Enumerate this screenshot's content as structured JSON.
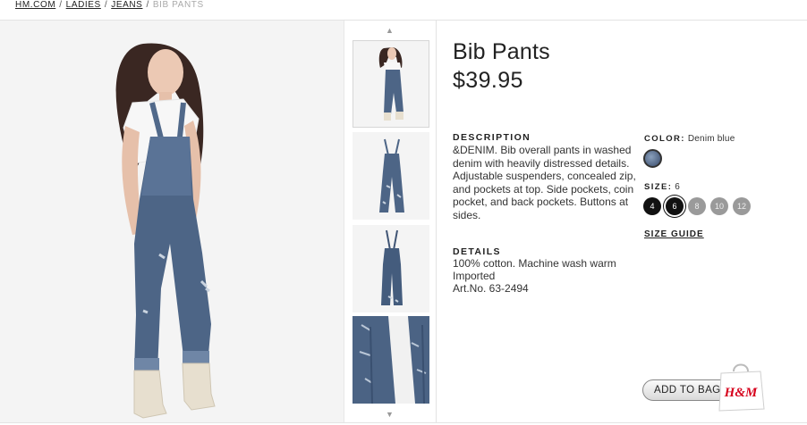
{
  "breadcrumb": {
    "items": [
      "HM.COM",
      "LADIES",
      "JEANS"
    ],
    "separator": "/",
    "current": "BIB PANTS"
  },
  "product": {
    "title": "Bib Pants",
    "price": "$39.95",
    "description": {
      "label": "DESCRIPTION",
      "text": "&DENIM. Bib overall pants in washed denim with heavily distressed details. Adjustable suspenders, concealed zip, and pockets at top. Side pockets, coin pocket, and back pockets. Buttons at sides."
    },
    "details": {
      "label": "DETAILS",
      "lines": [
        "100% cotton. Machine wash warm",
        "Imported",
        "Art.No. 63-2494"
      ]
    },
    "color": {
      "label": "COLOR:",
      "value": "Denim blue",
      "swatch_color": "#5b6f8f"
    },
    "size": {
      "label": "SIZE:",
      "value": "6",
      "options": [
        "4",
        "6",
        "8",
        "10",
        "12"
      ],
      "selected": "6",
      "available": [
        "4",
        "6"
      ]
    },
    "size_guide": "SIZE GUIDE",
    "add_to_bag": "ADD TO BAG",
    "bag_logo": "H&M"
  },
  "icons": {
    "scroll_up": "chevron-up-icon",
    "scroll_down": "chevron-down-icon",
    "shopping_bag": "shopping-bag-icon"
  },
  "colors": {
    "denim": "#4d6586",
    "brand_red": "#d6001c"
  }
}
